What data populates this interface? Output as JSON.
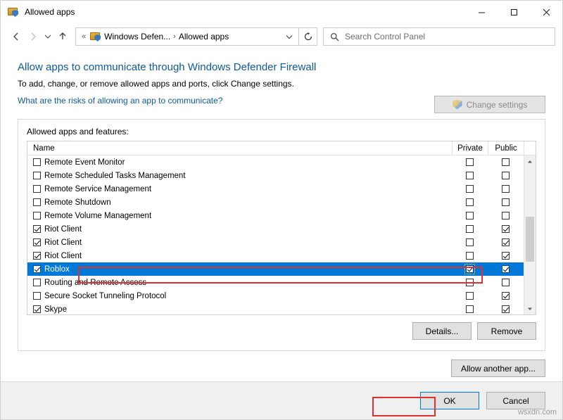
{
  "window": {
    "title": "Allowed apps",
    "icon": "firewall-shield-icon",
    "minimize": "minimize-icon",
    "maximize": "maximize-icon",
    "close": "close-icon"
  },
  "addressbar": {
    "back": "back-arrow-icon",
    "forward": "forward-arrow-icon",
    "recent": "chevron-down-icon",
    "up": "up-arrow-icon",
    "crumb_sep_first": "«",
    "crumbs": [
      "Windows Defen...",
      "Allowed apps"
    ],
    "crumb_sep": "›",
    "dropdown": "chevron-down-icon",
    "refresh": "refresh-icon",
    "search_placeholder": "Search Control Panel",
    "search_icon": "search-icon"
  },
  "page": {
    "title": "Allow apps to communicate through Windows Defender Firewall",
    "description": "To add, change, or remove allowed apps and ports, click Change settings.",
    "risk_link": "What are the risks of allowing an app to communicate?",
    "change_settings_button": "Change settings",
    "group_label": "Allowed apps and features:",
    "columns": [
      "Name",
      "Private",
      "Public"
    ],
    "rows": [
      {
        "name": "Remote Event Monitor",
        "name_checked": false,
        "private": false,
        "public": false
      },
      {
        "name": "Remote Scheduled Tasks Management",
        "name_checked": false,
        "private": false,
        "public": false
      },
      {
        "name": "Remote Service Management",
        "name_checked": false,
        "private": false,
        "public": false
      },
      {
        "name": "Remote Shutdown",
        "name_checked": false,
        "private": false,
        "public": false
      },
      {
        "name": "Remote Volume Management",
        "name_checked": false,
        "private": false,
        "public": false
      },
      {
        "name": "Riot Client",
        "name_checked": true,
        "private": false,
        "public": true
      },
      {
        "name": "Riot Client",
        "name_checked": true,
        "private": false,
        "public": true
      },
      {
        "name": "Riot Client",
        "name_checked": true,
        "private": false,
        "public": true
      },
      {
        "name": "Roblox",
        "name_checked": true,
        "private": true,
        "public": true,
        "selected": true
      },
      {
        "name": "Routing and Remote Access",
        "name_checked": false,
        "private": false,
        "public": false
      },
      {
        "name": "Secure Socket Tunneling Protocol",
        "name_checked": false,
        "private": false,
        "public": true
      },
      {
        "name": "Skype",
        "name_checked": true,
        "private": false,
        "public": true
      }
    ],
    "details_button": "Details...",
    "remove_button": "Remove",
    "allow_another_button": "Allow another app..."
  },
  "footer": {
    "ok_button": "OK",
    "cancel_button": "Cancel"
  },
  "watermark": "wsxdn.com",
  "colors": {
    "accent": "#0078d7",
    "link": "#0d5a9e",
    "annotation": "#e03030"
  }
}
